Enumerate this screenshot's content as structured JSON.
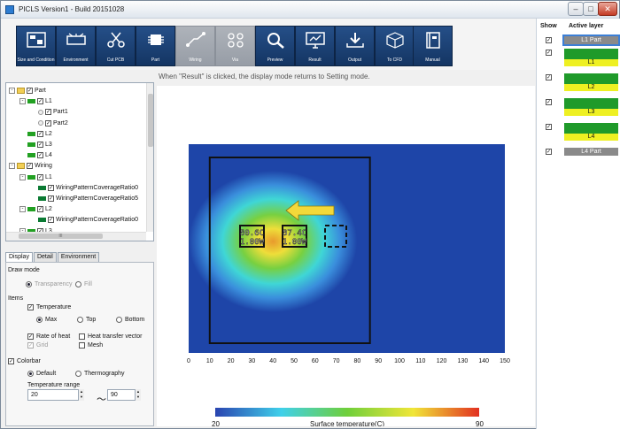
{
  "window": {
    "title": "PICLS Version1 - Build 20151028",
    "min": "–",
    "max": "□",
    "close": "✕"
  },
  "toolbar": [
    {
      "label": "Size and Condition",
      "icon": "board-icon",
      "enabled": true
    },
    {
      "label": "Environment",
      "icon": "environment-icon",
      "enabled": true
    },
    {
      "label": "Cut PCB",
      "icon": "scissors-icon",
      "enabled": true
    },
    {
      "label": "Part",
      "icon": "chip-icon",
      "enabled": true
    },
    {
      "label": "Wiring",
      "icon": "wiring-icon",
      "enabled": false
    },
    {
      "label": "Via",
      "icon": "via-icon",
      "enabled": false
    },
    {
      "label": "Preview",
      "icon": "magnifier-icon",
      "enabled": true
    },
    {
      "label": "Result",
      "icon": "monitor-icon",
      "enabled": true
    },
    {
      "label": "Output",
      "icon": "download-icon",
      "enabled": true
    },
    {
      "label": "To CFD",
      "icon": "cube-icon",
      "enabled": true
    },
    {
      "label": "Manual",
      "icon": "book-icon",
      "enabled": true
    }
  ],
  "hint": "When \"Result\" is clicked, the display mode returns to Setting mode.",
  "tree": {
    "items": [
      {
        "label": "Part",
        "level": 0,
        "type": "folder",
        "expanded": true
      },
      {
        "label": "L1",
        "level": 1,
        "type": "layer",
        "color": "#22a022",
        "expanded": true
      },
      {
        "label": "Part1",
        "level": 2,
        "type": "part"
      },
      {
        "label": "Part2",
        "level": 2,
        "type": "part"
      },
      {
        "label": "L2",
        "level": 1,
        "type": "layer",
        "color": "#22a022"
      },
      {
        "label": "L3",
        "level": 1,
        "type": "layer",
        "color": "#22a022"
      },
      {
        "label": "L4",
        "level": 1,
        "type": "layer",
        "color": "#22a022"
      },
      {
        "label": "Wiring",
        "level": 0,
        "type": "folder",
        "expanded": true
      },
      {
        "label": "L1",
        "level": 1,
        "type": "layer",
        "color": "#22a022",
        "expanded": true
      },
      {
        "label": "WiringPatternCoverageRatio0",
        "level": 2,
        "type": "wire",
        "color": "#0b7a33"
      },
      {
        "label": "WiringPatternCoverageRatio5",
        "level": 2,
        "type": "wire",
        "color": "#0b7a33"
      },
      {
        "label": "L2",
        "level": 1,
        "type": "layer",
        "color": "#22a022",
        "expanded": true
      },
      {
        "label": "WiringPatternCoverageRatio0",
        "level": 2,
        "type": "wire",
        "color": "#0b7a33"
      },
      {
        "label": "L3",
        "level": 1,
        "type": "layer",
        "color": "#22a022",
        "expanded": true
      }
    ],
    "hscroll_label": "III"
  },
  "tabs": [
    "Display",
    "Detail",
    "Environment"
  ],
  "display": {
    "draw_mode": "Draw mode",
    "transparency": "Transparency",
    "fill": "Fill",
    "items": "Items",
    "temperature": "Temperature",
    "max": "Max",
    "top": "Top",
    "bottom": "Bottom",
    "rate_of_heat": "Rate of heat",
    "heat_transfer_vector": "Heat transfer vector",
    "grid": "Grid",
    "mesh": "Mesh",
    "colorbar": "Colorbar",
    "default": "Default",
    "thermography": "Thermography",
    "temperature_range": "Temperature range",
    "range_min": "20",
    "range_max": "90",
    "tilde": "～"
  },
  "layers": {
    "show_header": "Show",
    "active_header": "Active layer",
    "items": [
      {
        "label": "L1 Part",
        "type": "part",
        "checked": true,
        "selected": true
      },
      {
        "label": "L1",
        "type": "layer",
        "checked": true
      },
      {
        "label": "L2",
        "type": "layer",
        "checked": true
      },
      {
        "label": "L3",
        "type": "layer",
        "checked": true
      },
      {
        "label": "L4",
        "type": "layer",
        "checked": true
      },
      {
        "label": "L4 Part",
        "type": "part",
        "checked": true
      }
    ]
  },
  "chart_data": {
    "type": "heatmap",
    "x_ticks": [
      0,
      10,
      20,
      30,
      40,
      50,
      60,
      70,
      80,
      90,
      100,
      110,
      120,
      130,
      140,
      150
    ],
    "xlim": [
      0,
      150
    ],
    "parts": [
      {
        "temp": "80.6C",
        "power": "1.00W"
      },
      {
        "temp": "87.4C",
        "power": "1.00W"
      }
    ],
    "colorbar": {
      "min": "20",
      "max": "90",
      "label": "Surface temperature(C)",
      "colors": [
        "#2a44b0",
        "#3fd0ea",
        "#6fcf3a",
        "#f0e638",
        "#e23020"
      ]
    },
    "colors": {
      "background": "#1e45a8",
      "arrow": "#f3d93a",
      "outline": "#111111"
    }
  }
}
